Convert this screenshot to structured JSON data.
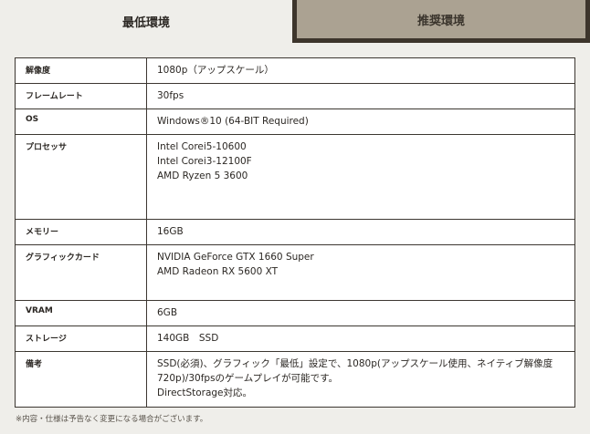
{
  "tabs": {
    "minimum_label": "最低環境",
    "recommended_label": "推奨環境"
  },
  "specs": [
    {
      "label": "解像度",
      "lines": [
        "1080p（アップスケール）"
      ]
    },
    {
      "label": "フレームレート",
      "lines": [
        "30fps"
      ]
    },
    {
      "label": "OS",
      "lines": [
        "Windows®10 (64-BIT Required)"
      ]
    },
    {
      "label": "プロセッサ",
      "lines": [
        "Intel Corei5-10600",
        "Intel Corei3-12100F",
        "AMD Ryzen 5 3600"
      ]
    },
    {
      "label": "メモリー",
      "lines": [
        "16GB"
      ]
    },
    {
      "label": "グラフィックカード",
      "lines": [
        "NVIDIA GeForce GTX 1660 Super",
        "AMD Radeon RX 5600 XT"
      ]
    },
    {
      "label": "VRAM",
      "lines": [
        "6GB"
      ]
    },
    {
      "label": "ストレージ",
      "lines": [
        "140GB　SSD"
      ]
    },
    {
      "label": "備考",
      "lines": [
        "SSD(必須)、グラフィック「最低」設定で、1080p(アップスケール使用、ネイティブ解像度",
        "720p)/30fpsのゲームプレイが可能です。",
        "DirectStorage対応。"
      ]
    }
  ],
  "footnote": "※内容・仕様は予告なく変更になる場合がございます。"
}
